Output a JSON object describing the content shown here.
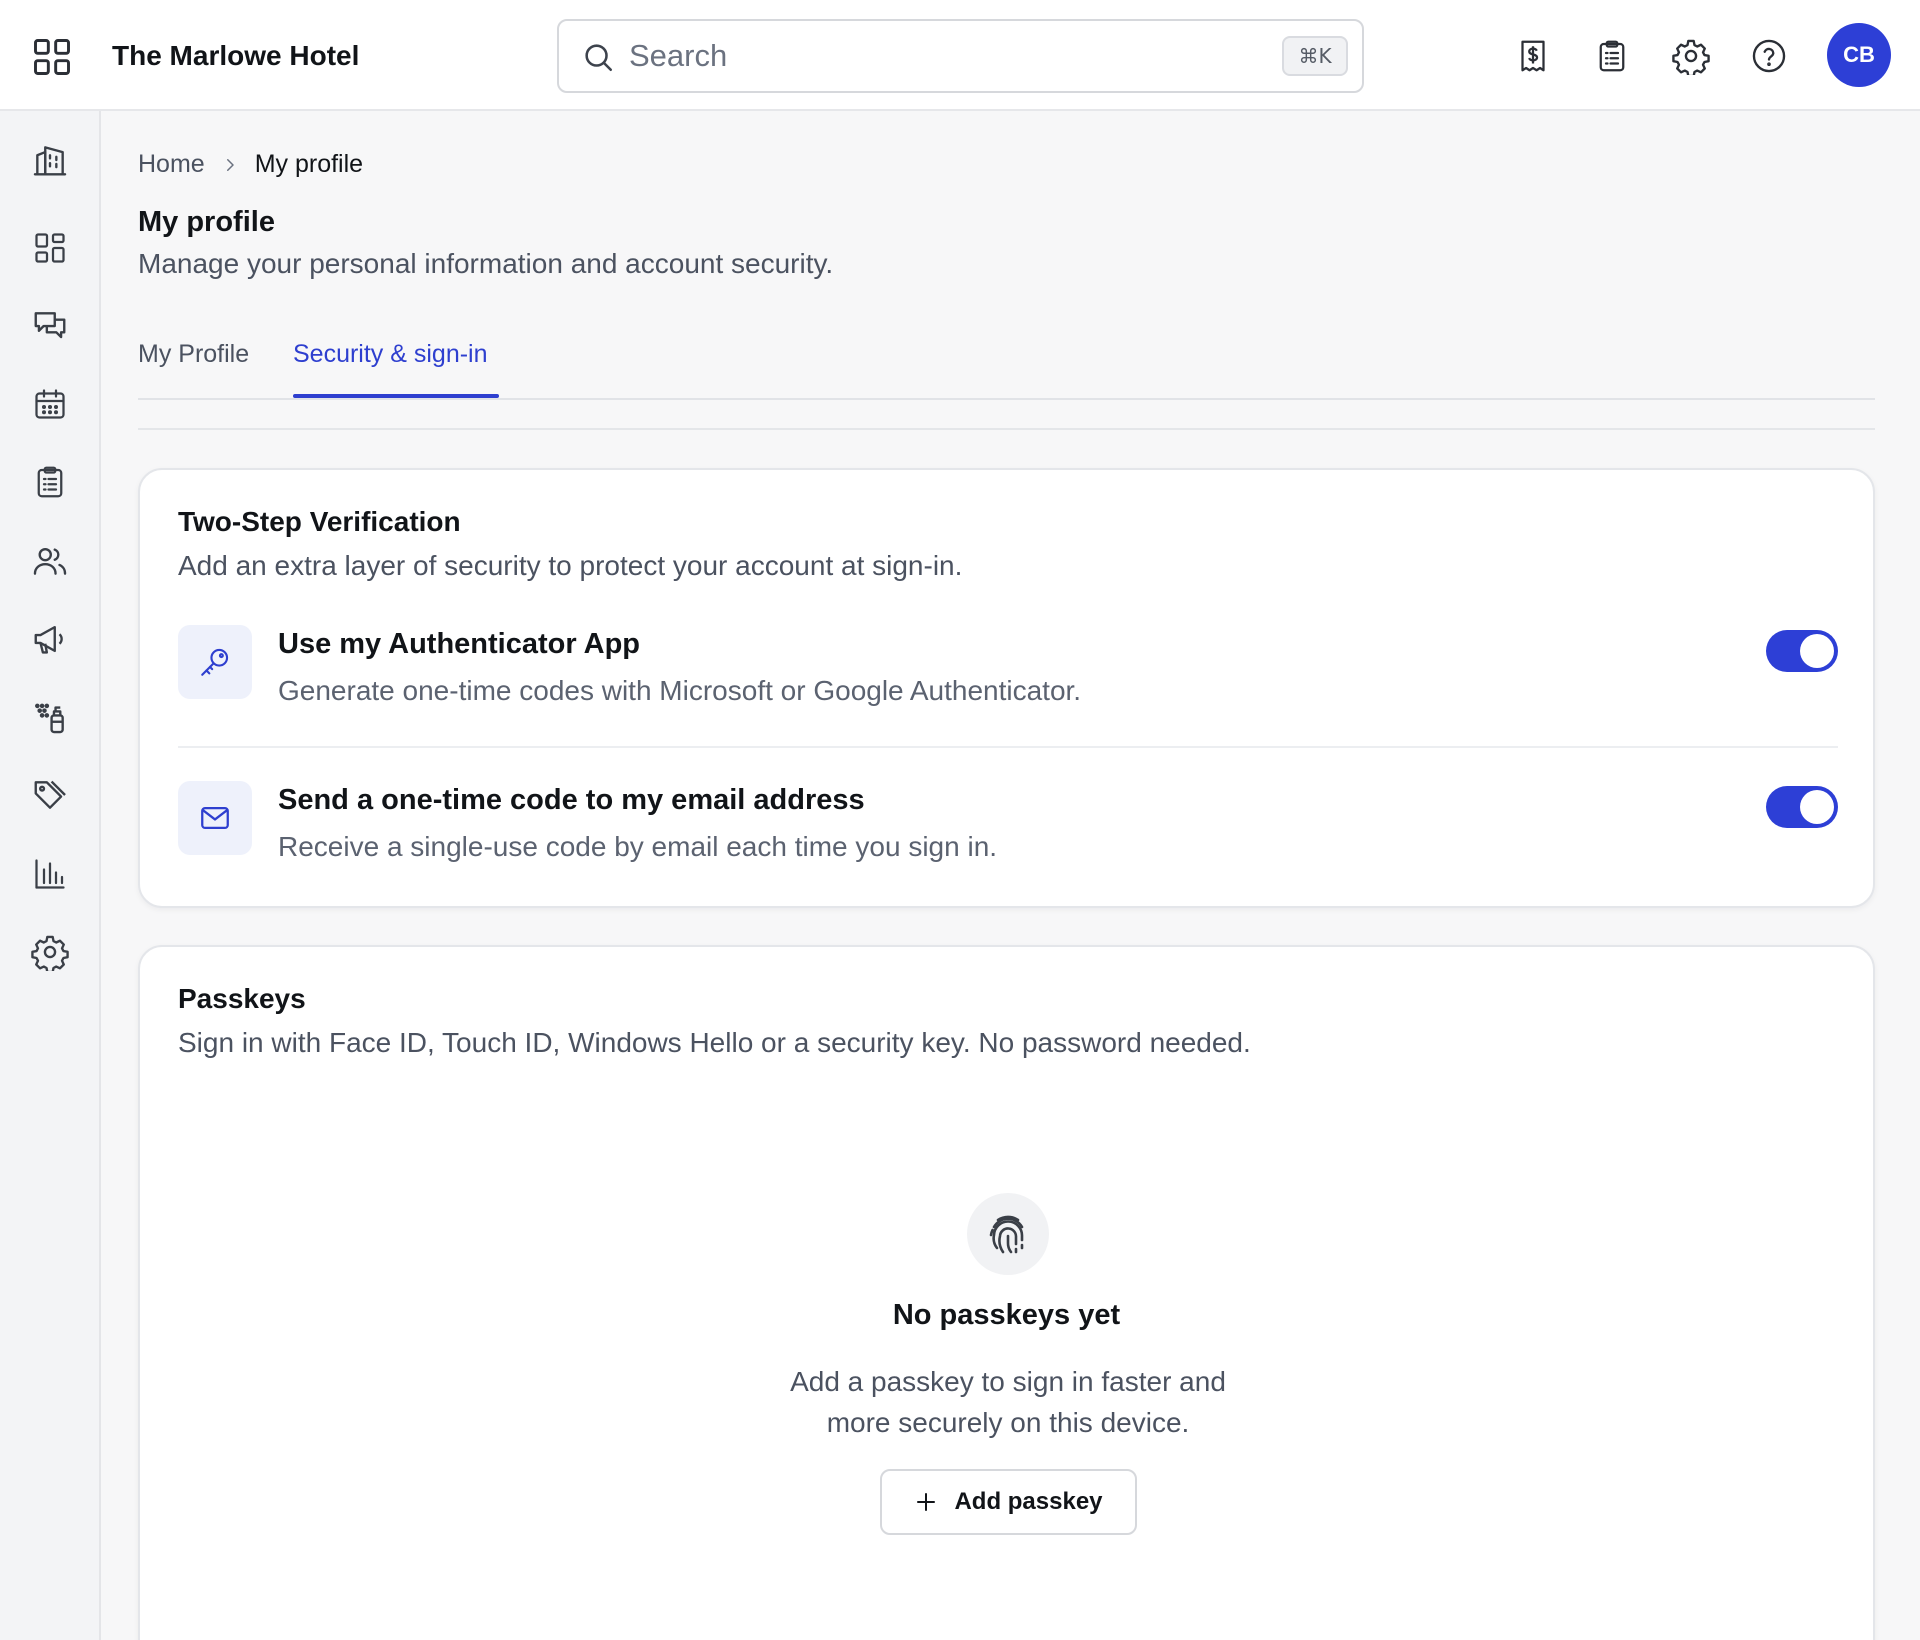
{
  "header": {
    "hotel_name": "The Marlowe Hotel",
    "search": {
      "placeholder": "Search",
      "shortcut": "⌘K"
    },
    "icons": [
      "dollar-receipt-icon",
      "clipboard-icon",
      "gear-icon",
      "help-icon"
    ],
    "avatar_initials": "CB",
    "accent_color": "#2d3fd6"
  },
  "sidebar": {
    "items": [
      {
        "icon": "building-icon"
      },
      {
        "icon": "dashboard-icon"
      },
      {
        "icon": "chat-icon"
      },
      {
        "icon": "calendar-icon"
      },
      {
        "icon": "clipboard-list-icon"
      },
      {
        "icon": "users-icon"
      },
      {
        "icon": "megaphone-icon"
      },
      {
        "icon": "cleaning-spray-icon"
      },
      {
        "icon": "tags-icon"
      },
      {
        "icon": "bar-chart-icon"
      },
      {
        "icon": "settings-icon"
      }
    ]
  },
  "breadcrumb": {
    "home": "Home",
    "current": "My profile"
  },
  "page": {
    "title": "My profile",
    "subtitle": "Manage your personal information and account security."
  },
  "tabs": [
    {
      "label": "My Profile",
      "active": false
    },
    {
      "label": "Security & sign-in",
      "active": true
    }
  ],
  "two_step": {
    "title": "Two-Step Verification",
    "subtitle": "Add an extra layer of security to protect your account at sign-in.",
    "options": [
      {
        "icon": "key-icon",
        "title": "Use my Authenticator App",
        "description": "Generate one-time codes with Microsoft or Google Authenticator.",
        "enabled": true
      },
      {
        "icon": "mail-icon",
        "title": "Send a one-time code to my email address",
        "description": "Receive a single-use code by email each time you sign in.",
        "enabled": true
      }
    ]
  },
  "passkeys": {
    "title": "Passkeys",
    "subtitle": "Sign in with Face ID, Touch ID, Windows Hello or a security key. No password needed.",
    "empty_title": "No passkeys yet",
    "empty_description": "Add a passkey to sign in faster and more securely on this device.",
    "add_button": "Add passkey",
    "empty_icon": "fingerprint-icon"
  }
}
